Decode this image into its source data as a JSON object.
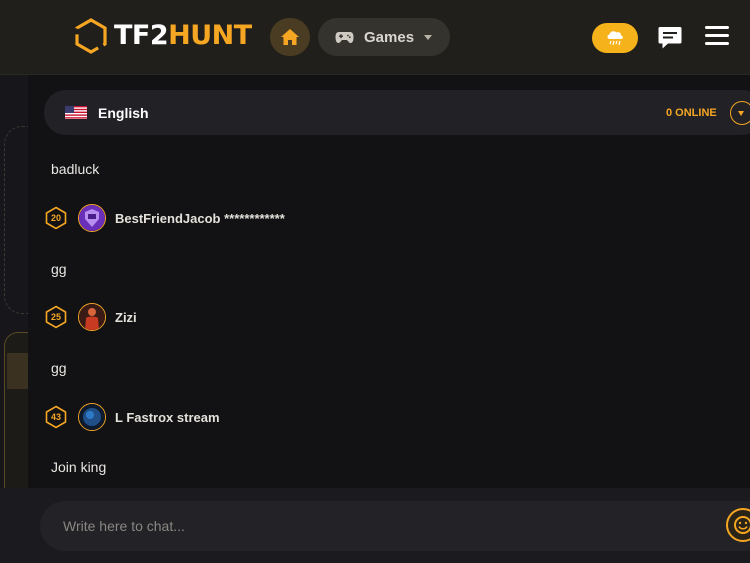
{
  "header": {
    "logo_white": "TF2",
    "logo_orange": "HUNT",
    "home_icon": "home-icon",
    "games_label": "Games",
    "games_icon": "gamepad-icon",
    "rain_icon": "cloud-rain-icon",
    "chat_icon": "chat-bubble-icon",
    "menu_icon": "hamburger-menu-icon"
  },
  "chat": {
    "language": "English",
    "flag": "us-flag-icon",
    "online": "0 ONLINE",
    "messages": [
      {
        "text": "badluck"
      },
      {
        "level": "20",
        "user": "BestFriendJacob ************"
      },
      {
        "text": "gg"
      },
      {
        "level": "25",
        "user": "Zizi"
      },
      {
        "text": "gg"
      },
      {
        "level": "43",
        "user": "L Fastrox stream"
      },
      {
        "text": "Join king"
      }
    ],
    "input_placeholder": "Write here to chat...",
    "emoji_icon": "smiley-icon"
  },
  "colors": {
    "accent": "#f5a623",
    "background": "#17161a",
    "panel": "#121214"
  }
}
